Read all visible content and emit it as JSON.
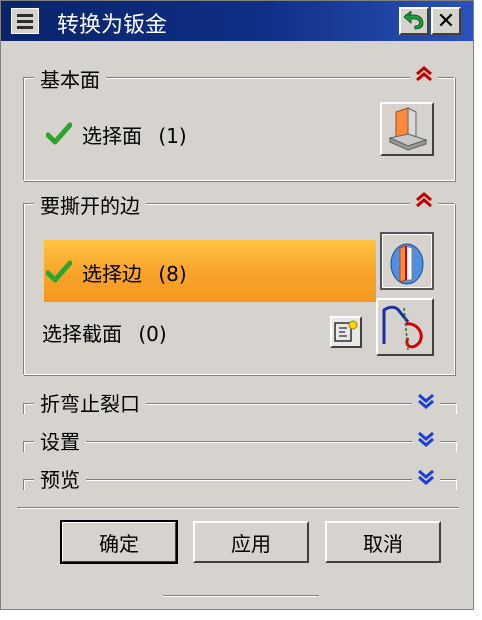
{
  "window": {
    "title": "转换为钣金"
  },
  "sections": {
    "base_face": {
      "label": "基本面",
      "state": "expanded",
      "select_label": "选择面",
      "count": "(1)",
      "status": "complete"
    },
    "rip_edges": {
      "label": "要撕开的边",
      "state": "expanded",
      "select_edge_label": "选择边",
      "select_edge_count": "(8)",
      "select_edge_status": "complete",
      "select_section_label": "选择截面",
      "select_section_count": "(0)"
    },
    "bend_relief": {
      "label": "折弯止裂口",
      "state": "collapsed"
    },
    "settings": {
      "label": "设置",
      "state": "collapsed"
    },
    "preview": {
      "label": "预览",
      "state": "collapsed"
    }
  },
  "buttons": {
    "ok": "确定",
    "apply": "应用",
    "cancel": "取消"
  },
  "colors": {
    "title_bar": "#0a246a",
    "dialog_bg": "#d6d3ce",
    "highlight": "#f9a22a",
    "check": "#2fa32f",
    "chevron_expand": "#c00000",
    "chevron_collapse": "#1a3fd6"
  },
  "icons": {
    "menu": "system-menu-icon",
    "reset": "reset-arrow-icon",
    "close": "close-icon",
    "face_select": "face-select-icon",
    "edge_select": "edge-select-icon",
    "section_add": "sketch-section-icon",
    "section_curve": "curve-section-icon",
    "check": "checkmark-icon",
    "collapse": "chevron-up-icon",
    "expand": "chevron-down-icon"
  }
}
